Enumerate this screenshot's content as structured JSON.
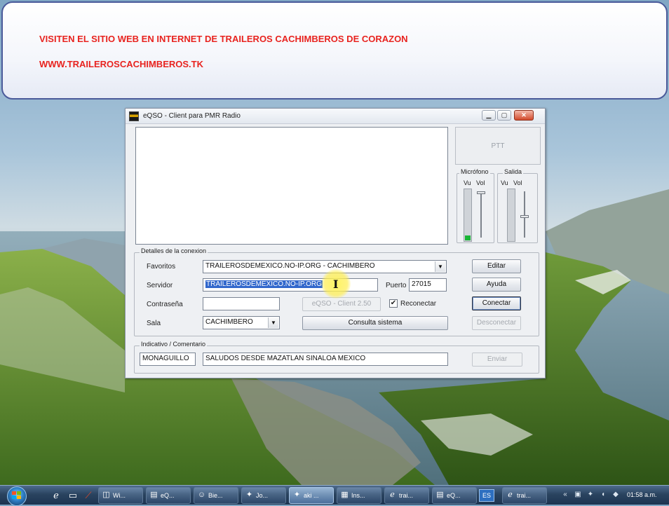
{
  "banner": {
    "line1": "VISITEN EL SITIO WEB EN INTERNET DE TRAILEROS CACHIMBEROS DE CORAZON",
    "line2": "WWW.TRAILEROSCACHIMBEROS.TK",
    "text_color": "#e8231f"
  },
  "window": {
    "title": "eQSO - Client para PMR Radio",
    "ptt_label": "PTT",
    "audio": {
      "mic_group": "Micrófono",
      "out_group": "Salida",
      "vu": "Vu",
      "vol": "Vol",
      "mic_level": 0.1
    },
    "connection": {
      "group_label": "Detalles de la conexion",
      "favoritos_label": "Favoritos",
      "favoritos_value": "TRAILEROSDEMEXICO.NO-IP.ORG - CACHIMBERO",
      "servidor_label": "Servidor",
      "servidor_value": "TRAILEROSDEMEXICO.NO-IP.ORG",
      "puerto_label": "Puerto",
      "puerto_value": "27015",
      "password_label": "Contraseña",
      "password_value": "",
      "version_button": "eQSO - Client  2.50",
      "reconnect_label": "Reconectar",
      "reconnect_checked": true,
      "sala_label": "Sala",
      "sala_value": "CACHIMBERO",
      "consulta_button": "Consulta sistema",
      "editar_button": "Editar",
      "ayuda_button": "Ayuda",
      "conectar_button": "Conectar",
      "desconectar_button": "Desconectar"
    },
    "callsign": {
      "group_label": "Indicativo / Comentario",
      "callsign_value": "MONAGUILLO",
      "comment_value": "SALUDOS DESDE MAZATLAN SINALOA MEXICO",
      "send_button": "Enviar"
    }
  },
  "taskbar": {
    "tasks": [
      {
        "label": "Wi...",
        "icon": "explorer-icon"
      },
      {
        "label": "eQ...",
        "icon": "eqso-icon"
      },
      {
        "label": "Bie...",
        "icon": "chat-icon"
      },
      {
        "label": "Jo...",
        "icon": "messenger-icon"
      },
      {
        "label": "aki ...",
        "icon": "messenger-icon"
      },
      {
        "label": "Ins...",
        "icon": "document-icon"
      },
      {
        "label": "trai...",
        "icon": "browser-icon"
      },
      {
        "label": "eQ...",
        "icon": "eqso-icon"
      },
      {
        "label": "trai...",
        "icon": "browser-icon"
      }
    ],
    "language": "ES",
    "clock": "01:58 a.m."
  }
}
